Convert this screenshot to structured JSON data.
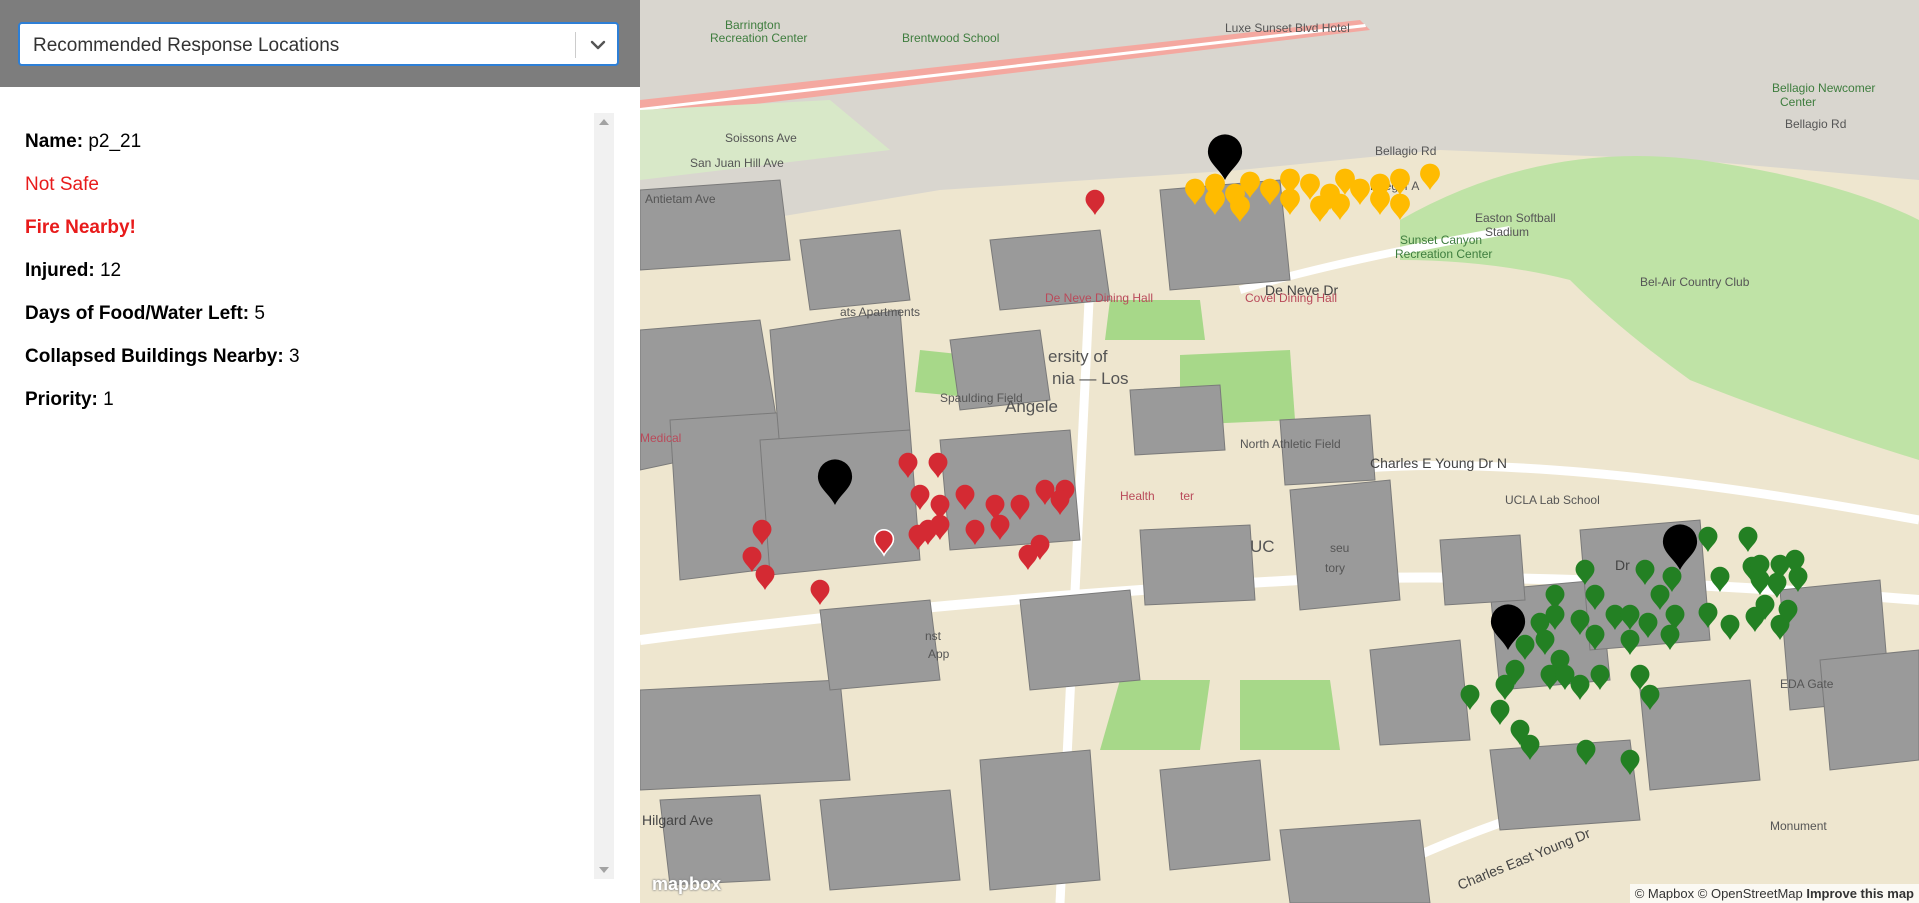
{
  "dropdown": {
    "selected": "Recommended Response Locations"
  },
  "location": {
    "name_label": "Name:",
    "name_value": "p2_21",
    "safety_status": "Not Safe",
    "fire_alert": "Fire Nearby!",
    "injured_label": "Injured:",
    "injured_value": "12",
    "food_label": "Days of Food/Water Left:",
    "food_value": "5",
    "collapsed_label": "Collapsed Buildings Nearby:",
    "collapsed_value": "3",
    "priority_label": "Priority:",
    "priority_value": "1"
  },
  "colors": {
    "not_safe": "#e81b1b",
    "marker_red": "#d42a33",
    "marker_yellow": "#ffbb00",
    "marker_green": "#238023",
    "marker_black": "#000000",
    "select_border": "#2d7fd6"
  },
  "map": {
    "labels": {
      "barrington": "Barrington",
      "recreation_center": "Recreation Center",
      "brentwood_school": "Brentwood School",
      "luxe_hotel": "Luxe Sunset Blvd Hotel",
      "soissons": "Soissons Ave",
      "san_juan": "San Juan Hill Ave",
      "antietam": "Antietam Ave",
      "krieger": "Krieger A",
      "easton": "Easton Softball",
      "stadium": "Stadium",
      "sunset_canyon": "Sunset Canyon",
      "recreation_center2": "Recreation Center",
      "bellagio": "Bellagio Rd",
      "bellagio2": "Bellagio Rd",
      "belair": "Bel-Air Country Club",
      "bellagio_newcomer": "Bellagio Newcomer",
      "center": "Center",
      "de_neve_dr": "De Neve Dr",
      "de_neve_dining": "De Neve Dining Hall",
      "covel_dining": "Covel Dining Hall",
      "apartments": "ats Apartments",
      "university": "ersity of",
      "university2": "nia — Los",
      "spaulding": "Spaulding Field",
      "angeles": "Angele",
      "north_athletic": "North Athletic Field",
      "charles_young_n": "Charles E Young Dr N",
      "ucla_lab_school": "UCLA Lab School",
      "health": "Health",
      "center_short": "ter",
      "medical": "Medical",
      "uc": "UC",
      "museum": "seu",
      "history": "tory",
      "dr": "Dr",
      "eda_gate": "EDA Gate",
      "inst": "nst",
      "app": "App",
      "hilgard": "Hilgard Ave",
      "charles_east": "Charles East Young Dr",
      "monument": "Monument"
    },
    "mapbox_logo": "mapbox",
    "attribution": {
      "mapbox": "© Mapbox",
      "osm": "© OpenStreetMap",
      "improve": "Improve this map"
    }
  }
}
